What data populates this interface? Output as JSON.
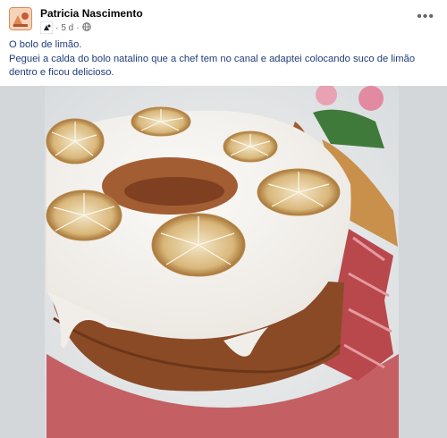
{
  "post": {
    "author": "Patricia Nascimento",
    "time": "5 d",
    "separator": "·",
    "more_icon": "more-horizontal-icon",
    "caption_line1": "O bolo de limão.",
    "caption_line2": "Peguei a calda do bolo natalino que a chef tem no canal e adaptei colocando suco de limão dentro e ficou delicioso."
  },
  "colors": {
    "caption_text": "#1f3d7a",
    "meta_text": "#65676b",
    "cake_crumb": "#8a4a25",
    "glaze": "#f4f1ec",
    "plate": "#b84a4f"
  }
}
